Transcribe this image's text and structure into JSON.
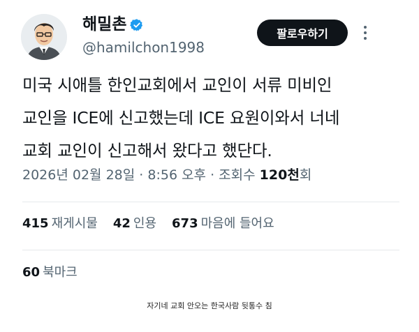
{
  "author": {
    "display_name": "해밀촌",
    "handle": "@hamilchon1998",
    "verified_color": "#1d9bf0"
  },
  "follow_button": {
    "label": "팔로우하기"
  },
  "tweet": {
    "lines": [
      "미국 시애틀 한인교회에서 교인이 서류 미비인",
      "교인을 ICE에 신고했는데 ICE 요원이와서 너네",
      "교회 교인이 신고해서 왔다고 했단다."
    ]
  },
  "meta": {
    "date": "2026년 02월 28일",
    "separator": " · ",
    "time": "8:56 오후",
    "views_label": "조회수",
    "views_count": "120천",
    "views_suffix": "회"
  },
  "stats": {
    "reposts": {
      "count": "415",
      "label": "재게시물"
    },
    "quotes": {
      "count": "42",
      "label": "인용"
    },
    "likes": {
      "count": "673",
      "label": "마음에 들어요"
    }
  },
  "bookmarks": {
    "count": "60",
    "label": "북마크"
  },
  "caption": "자기네 교회 안오는 한국사람 뒷통수 침",
  "icons": {
    "verified": "verified-badge-icon",
    "more": "more-options-icon"
  }
}
